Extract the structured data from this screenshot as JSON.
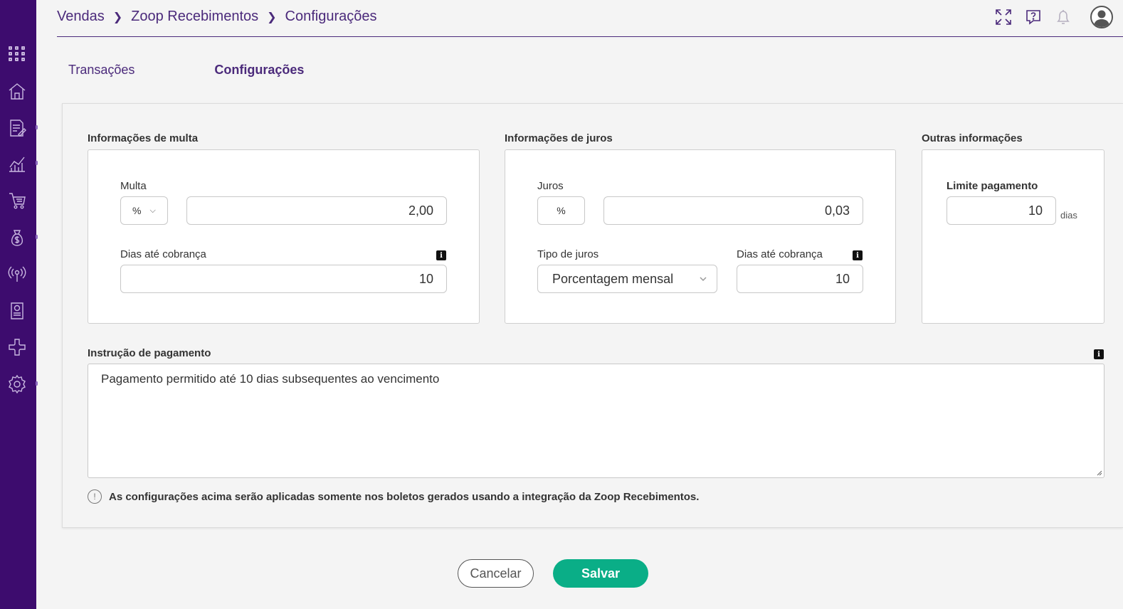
{
  "breadcrumb": [
    "Vendas",
    "Zoop Recebimentos",
    "Configurações"
  ],
  "tabs": [
    {
      "label": "Transações",
      "active": false
    },
    {
      "label": "Configurações",
      "active": true
    }
  ],
  "multa": {
    "title": "Informações de multa",
    "label": "Multa",
    "unit": "%",
    "value": "2,00",
    "dias_label": "Dias até cobrança",
    "dias_value": "10"
  },
  "juros": {
    "title": "Informações de juros",
    "label": "Juros",
    "unit": "%",
    "value": "0,03",
    "tipo_label": "Tipo de juros",
    "tipo_value": "Porcentagem mensal",
    "dias_label": "Dias até cobrança",
    "dias_value": "10"
  },
  "outras": {
    "title": "Outras informações",
    "limite_label": "Limite pagamento",
    "limite_value": "10",
    "limite_unit": "dias"
  },
  "instrucao": {
    "label": "Instrução de pagamento",
    "value": "Pagamento permitido até 10 dias subsequentes ao vencimento"
  },
  "notice": "As configurações acima serão aplicadas somente nos boletos gerados usando a integração da Zoop Recebimentos.",
  "buttons": {
    "cancel": "Cancelar",
    "save": "Salvar"
  },
  "colors": {
    "sidebar": "#3d0c6e",
    "accent": "#4b2a7b",
    "save": "#0aae87"
  },
  "icons": {
    "sidebar": [
      "apps-grid-icon",
      "home-icon",
      "document-edit-icon",
      "bar-chart-icon",
      "cart-icon",
      "money-bag-icon",
      "broadcast-icon",
      "receipt-icon",
      "plugin-icon",
      "gear-icon"
    ],
    "header": [
      "fullscreen-icon",
      "help-icon",
      "bell-icon",
      "user-avatar-icon"
    ]
  }
}
